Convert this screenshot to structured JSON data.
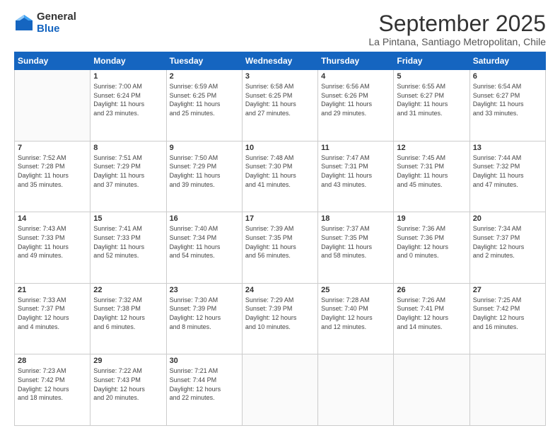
{
  "logo": {
    "general": "General",
    "blue": "Blue"
  },
  "title": "September 2025",
  "subtitle": "La Pintana, Santiago Metropolitan, Chile",
  "days": [
    "Sunday",
    "Monday",
    "Tuesday",
    "Wednesday",
    "Thursday",
    "Friday",
    "Saturday"
  ],
  "weeks": [
    [
      {
        "day": "",
        "info": ""
      },
      {
        "day": "1",
        "info": "Sunrise: 7:00 AM\nSunset: 6:24 PM\nDaylight: 11 hours\nand 23 minutes."
      },
      {
        "day": "2",
        "info": "Sunrise: 6:59 AM\nSunset: 6:25 PM\nDaylight: 11 hours\nand 25 minutes."
      },
      {
        "day": "3",
        "info": "Sunrise: 6:58 AM\nSunset: 6:25 PM\nDaylight: 11 hours\nand 27 minutes."
      },
      {
        "day": "4",
        "info": "Sunrise: 6:56 AM\nSunset: 6:26 PM\nDaylight: 11 hours\nand 29 minutes."
      },
      {
        "day": "5",
        "info": "Sunrise: 6:55 AM\nSunset: 6:27 PM\nDaylight: 11 hours\nand 31 minutes."
      },
      {
        "day": "6",
        "info": "Sunrise: 6:54 AM\nSunset: 6:27 PM\nDaylight: 11 hours\nand 33 minutes."
      }
    ],
    [
      {
        "day": "7",
        "info": "Sunrise: 7:52 AM\nSunset: 7:28 PM\nDaylight: 11 hours\nand 35 minutes."
      },
      {
        "day": "8",
        "info": "Sunrise: 7:51 AM\nSunset: 7:29 PM\nDaylight: 11 hours\nand 37 minutes."
      },
      {
        "day": "9",
        "info": "Sunrise: 7:50 AM\nSunset: 7:29 PM\nDaylight: 11 hours\nand 39 minutes."
      },
      {
        "day": "10",
        "info": "Sunrise: 7:48 AM\nSunset: 7:30 PM\nDaylight: 11 hours\nand 41 minutes."
      },
      {
        "day": "11",
        "info": "Sunrise: 7:47 AM\nSunset: 7:31 PM\nDaylight: 11 hours\nand 43 minutes."
      },
      {
        "day": "12",
        "info": "Sunrise: 7:45 AM\nSunset: 7:31 PM\nDaylight: 11 hours\nand 45 minutes."
      },
      {
        "day": "13",
        "info": "Sunrise: 7:44 AM\nSunset: 7:32 PM\nDaylight: 11 hours\nand 47 minutes."
      }
    ],
    [
      {
        "day": "14",
        "info": "Sunrise: 7:43 AM\nSunset: 7:33 PM\nDaylight: 11 hours\nand 49 minutes."
      },
      {
        "day": "15",
        "info": "Sunrise: 7:41 AM\nSunset: 7:33 PM\nDaylight: 11 hours\nand 52 minutes."
      },
      {
        "day": "16",
        "info": "Sunrise: 7:40 AM\nSunset: 7:34 PM\nDaylight: 11 hours\nand 54 minutes."
      },
      {
        "day": "17",
        "info": "Sunrise: 7:39 AM\nSunset: 7:35 PM\nDaylight: 11 hours\nand 56 minutes."
      },
      {
        "day": "18",
        "info": "Sunrise: 7:37 AM\nSunset: 7:35 PM\nDaylight: 11 hours\nand 58 minutes."
      },
      {
        "day": "19",
        "info": "Sunrise: 7:36 AM\nSunset: 7:36 PM\nDaylight: 12 hours\nand 0 minutes."
      },
      {
        "day": "20",
        "info": "Sunrise: 7:34 AM\nSunset: 7:37 PM\nDaylight: 12 hours\nand 2 minutes."
      }
    ],
    [
      {
        "day": "21",
        "info": "Sunrise: 7:33 AM\nSunset: 7:37 PM\nDaylight: 12 hours\nand 4 minutes."
      },
      {
        "day": "22",
        "info": "Sunrise: 7:32 AM\nSunset: 7:38 PM\nDaylight: 12 hours\nand 6 minutes."
      },
      {
        "day": "23",
        "info": "Sunrise: 7:30 AM\nSunset: 7:39 PM\nDaylight: 12 hours\nand 8 minutes."
      },
      {
        "day": "24",
        "info": "Sunrise: 7:29 AM\nSunset: 7:39 PM\nDaylight: 12 hours\nand 10 minutes."
      },
      {
        "day": "25",
        "info": "Sunrise: 7:28 AM\nSunset: 7:40 PM\nDaylight: 12 hours\nand 12 minutes."
      },
      {
        "day": "26",
        "info": "Sunrise: 7:26 AM\nSunset: 7:41 PM\nDaylight: 12 hours\nand 14 minutes."
      },
      {
        "day": "27",
        "info": "Sunrise: 7:25 AM\nSunset: 7:42 PM\nDaylight: 12 hours\nand 16 minutes."
      }
    ],
    [
      {
        "day": "28",
        "info": "Sunrise: 7:23 AM\nSunset: 7:42 PM\nDaylight: 12 hours\nand 18 minutes."
      },
      {
        "day": "29",
        "info": "Sunrise: 7:22 AM\nSunset: 7:43 PM\nDaylight: 12 hours\nand 20 minutes."
      },
      {
        "day": "30",
        "info": "Sunrise: 7:21 AM\nSunset: 7:44 PM\nDaylight: 12 hours\nand 22 minutes."
      },
      {
        "day": "",
        "info": ""
      },
      {
        "day": "",
        "info": ""
      },
      {
        "day": "",
        "info": ""
      },
      {
        "day": "",
        "info": ""
      }
    ]
  ]
}
